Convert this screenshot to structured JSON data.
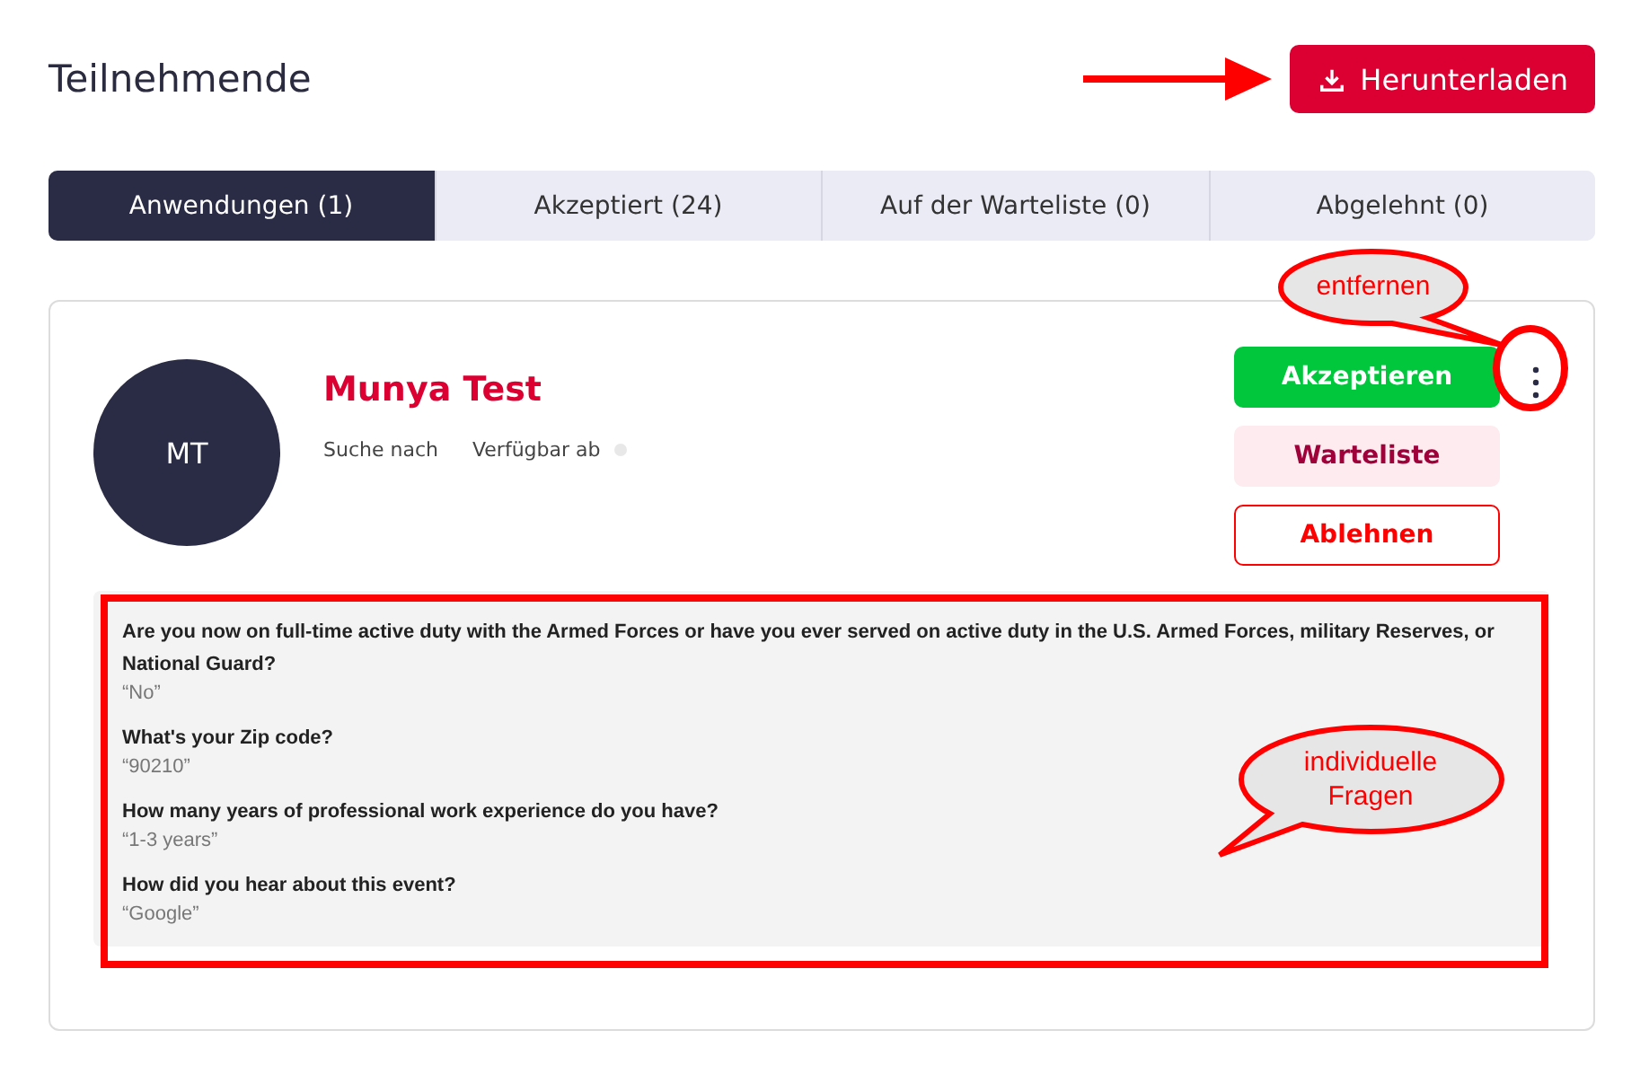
{
  "page_title": "Teilnehmende",
  "download_button": {
    "label": "Herunterladen"
  },
  "tabs": [
    {
      "label": "Anwendungen (1)",
      "selected": true
    },
    {
      "label": "Akzeptiert (24)",
      "selected": false
    },
    {
      "label": "Auf der Warteliste (0)",
      "selected": false
    },
    {
      "label": "Abgelehnt (0)",
      "selected": false
    }
  ],
  "applicant": {
    "initials": "MT",
    "name": "Munya Test",
    "meta": [
      "Suche nach",
      "Verfügbar ab"
    ],
    "actions": [
      {
        "label": "Akzeptieren",
        "kind": "accept"
      },
      {
        "label": "Warteliste",
        "kind": "waitlist"
      },
      {
        "label": "Ablehnen",
        "kind": "reject"
      }
    ],
    "questions": [
      {
        "question": "Are you now on full-time active duty with the Armed Forces or have you ever served on active duty in the U.S. Armed Forces, military Reserves, or National Guard?",
        "answer": "“No”"
      },
      {
        "question": "What's your Zip code?",
        "answer": "“90210”"
      },
      {
        "question": "How many years of professional work experience do you have?",
        "answer": "“1-3 years”"
      },
      {
        "question": "How did you hear about this event?",
        "answer": "“Google”"
      }
    ]
  },
  "annotations": [
    {
      "kind": "arrow"
    },
    {
      "kind": "menucallout",
      "text": "entfernen"
    },
    {
      "kind": "questioncallout",
      "text": "individuelle Fragen"
    }
  ]
}
